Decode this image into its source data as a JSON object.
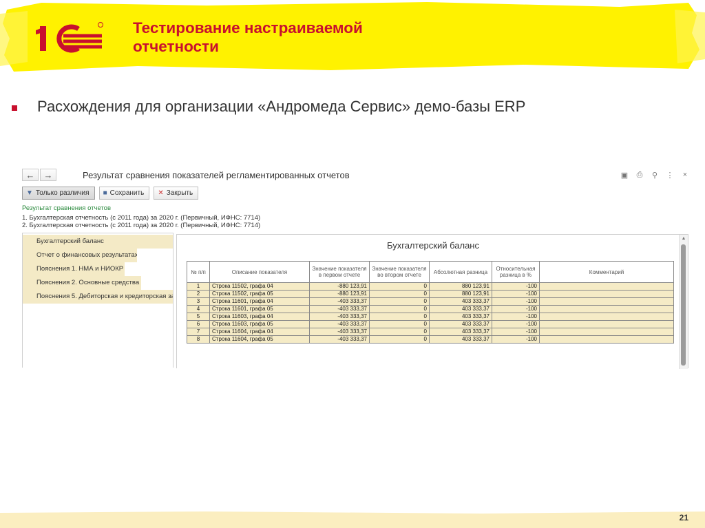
{
  "slide": {
    "title_line1": "Тестирование настраиваемой",
    "title_line2": "отчетности",
    "bullet": "Расхождения для организации «Андромеда Сервис» демо-базы  ERP",
    "page_number": "21"
  },
  "colors": {
    "accent": "#c8102e",
    "highlight": "#fff200",
    "row_fill": "#f5ebc6"
  },
  "window": {
    "back_icon": "arrow-left-icon",
    "forward_icon": "arrow-right-icon",
    "title": "Результат сравнения показателей регламентированных отчетов",
    "tools": [
      "save-icon",
      "print-icon",
      "preview-icon",
      "more-icon",
      "close-icon"
    ]
  },
  "toolbar": {
    "only_diff_label": "Только различия",
    "save_label": "Сохранить",
    "close_label": "Закрыть"
  },
  "comparison": {
    "header": "Результат сравнения отчетов",
    "lines": [
      "1. Бухгалтерская отчетность (с 2011 года) за 2020 г. (Первичный, ИФНС: 7714)",
      "2. Бухгалтерская отчетность (с 2011 года) за 2020 г. (Первичный, ИФНС: 7714)"
    ]
  },
  "sections": [
    "Бухгалтерский баланс",
    "Отчет о финансовых результатах",
    "Пояснения 1. НМА и НИОКР",
    "Пояснения 2. Основные средства",
    "Пояснения 5. Дебиторская и кредиторская за"
  ],
  "report": {
    "title": "Бухгалтерский баланс",
    "columns": [
      "№ п/п",
      "Описание показателя",
      "Значение показателя в первом отчете",
      "Значение показателя во втором отчете",
      "Абсолютная разница",
      "Относительная разница в %",
      "Комментарий"
    ],
    "rows": [
      [
        "1",
        "Строка 11502, графа 04",
        "-880 123,91",
        "0",
        "880 123,91",
        "-100",
        ""
      ],
      [
        "2",
        "Строка 11502, графа 05",
        "-880 123,91",
        "0",
        "880 123,91",
        "-100",
        ""
      ],
      [
        "3",
        "Строка 11601, графа 04",
        "-403 333,37",
        "0",
        "403 333,37",
        "-100",
        ""
      ],
      [
        "4",
        "Строка 11601, графа 05",
        "-403 333,37",
        "0",
        "403 333,37",
        "-100",
        ""
      ],
      [
        "5",
        "Строка 11603, графа 04",
        "-403 333,37",
        "0",
        "403 333,37",
        "-100",
        ""
      ],
      [
        "6",
        "Строка 11603, графа 05",
        "-403 333,37",
        "0",
        "403 333,37",
        "-100",
        ""
      ],
      [
        "7",
        "Строка 11604, графа 04",
        "-403 333,37",
        "0",
        "403 333,37",
        "-100",
        ""
      ],
      [
        "8",
        "Строка 11604, графа 05",
        "-403 333,37",
        "0",
        "403 333,37",
        "-100",
        ""
      ]
    ]
  }
}
